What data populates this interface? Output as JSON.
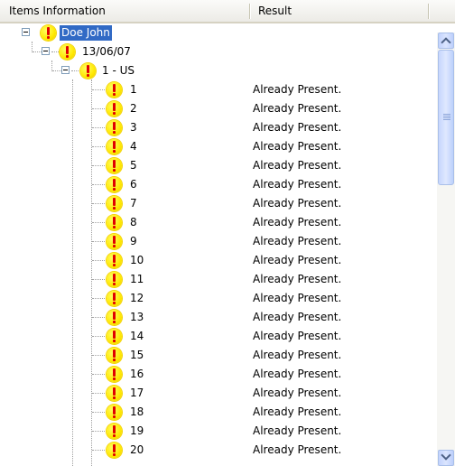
{
  "columns": {
    "items": "Items Information",
    "result": "Result"
  },
  "tree": {
    "root": {
      "label": "Doe John",
      "icon": "warning-icon"
    },
    "date": {
      "label": "13/06/07",
      "icon": "warning-icon"
    },
    "group": {
      "label": "1 - US",
      "icon": "warning-icon"
    },
    "items": [
      {
        "label": "1",
        "result": "Already Present."
      },
      {
        "label": "2",
        "result": "Already Present."
      },
      {
        "label": "3",
        "result": "Already Present."
      },
      {
        "label": "4",
        "result": "Already Present."
      },
      {
        "label": "5",
        "result": "Already Present."
      },
      {
        "label": "6",
        "result": "Already Present."
      },
      {
        "label": "7",
        "result": "Already Present."
      },
      {
        "label": "8",
        "result": "Already Present."
      },
      {
        "label": "9",
        "result": "Already Present."
      },
      {
        "label": "10",
        "result": "Already Present."
      },
      {
        "label": "11",
        "result": "Already Present."
      },
      {
        "label": "12",
        "result": "Already Present."
      },
      {
        "label": "13",
        "result": "Already Present."
      },
      {
        "label": "14",
        "result": "Already Present."
      },
      {
        "label": "15",
        "result": "Already Present."
      },
      {
        "label": "16",
        "result": "Already Present."
      },
      {
        "label": "17",
        "result": "Already Present."
      },
      {
        "label": "18",
        "result": "Already Present."
      },
      {
        "label": "19",
        "result": "Already Present."
      },
      {
        "label": "20",
        "result": "Already Present."
      }
    ]
  },
  "colors": {
    "selection": "#316ac5",
    "warning": "#ffe800",
    "warning_mark": "#e00000"
  }
}
